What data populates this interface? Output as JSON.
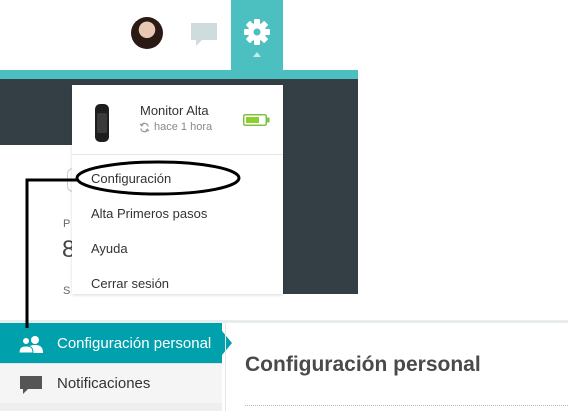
{
  "header": {
    "icons": [
      "avatar",
      "chat-icon",
      "gear-icon"
    ],
    "accent_color": "#4cbfc0"
  },
  "dropdown": {
    "device": {
      "name": "Monitor Alta",
      "sync_time": "hace 1 hora",
      "battery": "full"
    },
    "items": [
      {
        "label": "Configuración"
      },
      {
        "label": "Alta Primeros pasos"
      },
      {
        "label": "Ayuda"
      },
      {
        "label": "Cerrar sesión"
      }
    ]
  },
  "background_peek": {
    "line1": "P",
    "line2": "8",
    "line3": "S"
  },
  "sidebar": {
    "items": [
      {
        "label": "Configuración personal",
        "icon": "users-icon",
        "active": true
      },
      {
        "label": "Notificaciones",
        "icon": "speech-bubble-icon",
        "active": false
      }
    ],
    "active_color": "#00a1ad"
  },
  "main": {
    "title": "Configuración personal"
  }
}
